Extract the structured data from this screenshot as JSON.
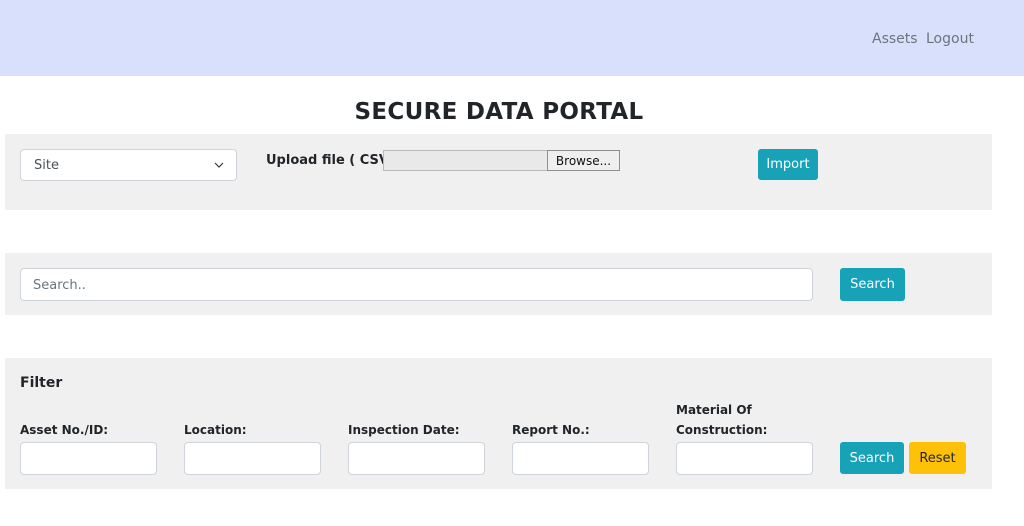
{
  "nav": {
    "links": [
      "Assets",
      "Logout"
    ]
  },
  "page": {
    "title": "SECURE DATA PORTAL"
  },
  "upload": {
    "site_select": "Site",
    "label": "Upload file ( CSV ):",
    "browse": "Browse...",
    "import": "Import"
  },
  "search": {
    "placeholder": "Search..",
    "button": "Search"
  },
  "filter": {
    "title": "Filter",
    "fields": [
      "Asset No./ID:",
      "Location:",
      "Inspection Date:",
      "Report No.:",
      "Material Of Construction:"
    ],
    "search_button": "Search",
    "reset_button": "Reset"
  },
  "colors": {
    "navbar": "#d9e0fc",
    "panel": "#f0f0f0",
    "info": "#17a2b8",
    "warning": "#ffc107"
  }
}
